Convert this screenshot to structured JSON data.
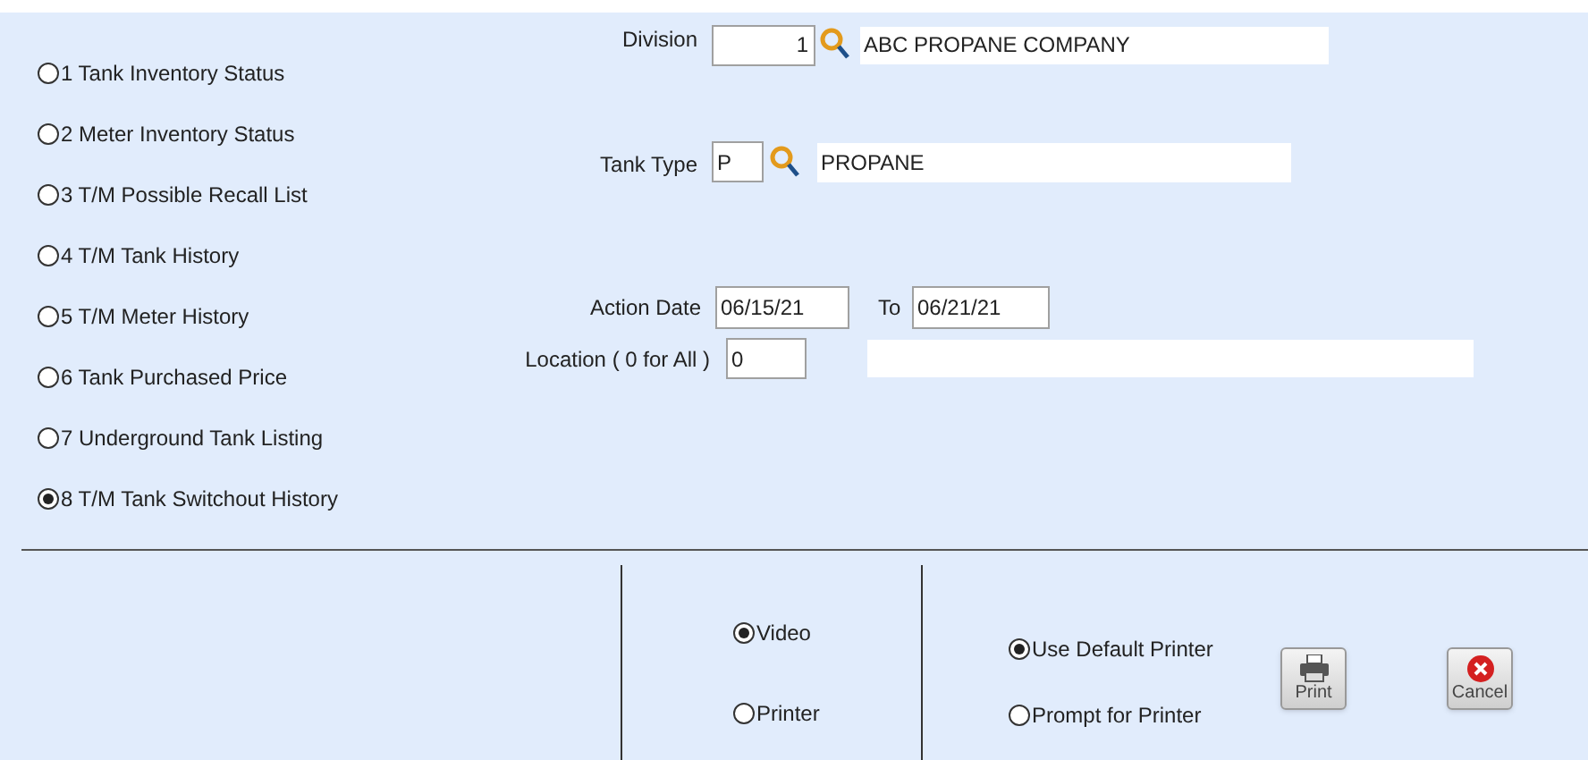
{
  "reports": [
    {
      "label": "1 Tank Inventory Status",
      "selected": false
    },
    {
      "label": "2 Meter Inventory Status",
      "selected": false
    },
    {
      "label": "3 T/M Possible Recall List",
      "selected": false
    },
    {
      "label": "4 T/M Tank History",
      "selected": false
    },
    {
      "label": "5 T/M Meter History",
      "selected": false
    },
    {
      "label": "6 Tank Purchased Price",
      "selected": false
    },
    {
      "label": "7 Underground Tank Listing",
      "selected": false
    },
    {
      "label": "8 T/M Tank Switchout History",
      "selected": true
    }
  ],
  "division": {
    "label": "Division",
    "value": "1",
    "description": "ABC PROPANE COMPANY"
  },
  "tank_type": {
    "label": "Tank Type",
    "value": "P",
    "description": "PROPANE"
  },
  "action_date": {
    "label": "Action Date",
    "from": "06/15/21",
    "to_label": "To",
    "to": "06/21/21"
  },
  "location": {
    "label": "Location ( 0 for All )",
    "value": "0"
  },
  "output": [
    {
      "label": "Video",
      "selected": true
    },
    {
      "label": "Printer",
      "selected": false
    }
  ],
  "printer": [
    {
      "label": "Use Default Printer",
      "selected": true
    },
    {
      "label": "Prompt for Printer",
      "selected": false
    }
  ],
  "buttons": [
    {
      "kind": "print",
      "label": "Print"
    },
    {
      "kind": "cancel",
      "label": "Cancel"
    }
  ]
}
